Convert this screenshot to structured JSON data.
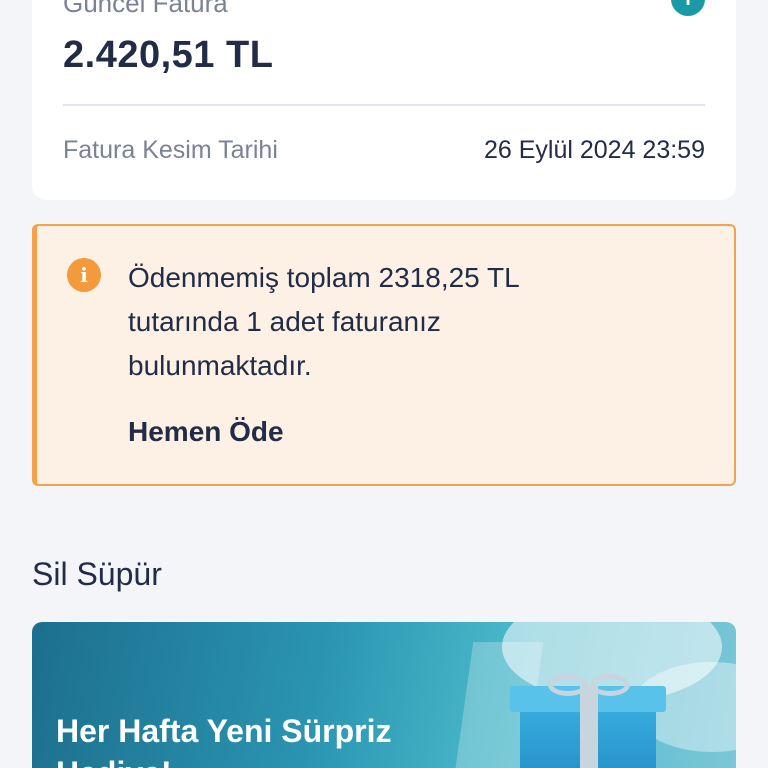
{
  "invoice": {
    "label": "Güncel Fatura",
    "info_icon": "i",
    "amount": "2.420,51 TL",
    "cut_date_label": "Fatura Kesim Tarihi",
    "cut_date_value": "26 Eylül 2024 23:59"
  },
  "warning": {
    "icon": "i",
    "message": "Ödenmemiş toplam 2318,25 TL tutarında 1 adet faturanız bulunmaktadır.",
    "action_label": "Hemen Öde",
    "colors": {
      "border": "#f5a14d",
      "background": "#fdf1e6",
      "icon": "#f29a3c"
    }
  },
  "section": {
    "title": "Sil Süpür"
  },
  "banner": {
    "title": "Her Hafta Yeni Sürpriz Hediye!",
    "image_icon": "gift-box-icon"
  },
  "colors": {
    "accent": "#1a9aa6",
    "text": "#222c47",
    "muted": "#7a8296",
    "page_bg": "#f4f5f9"
  }
}
